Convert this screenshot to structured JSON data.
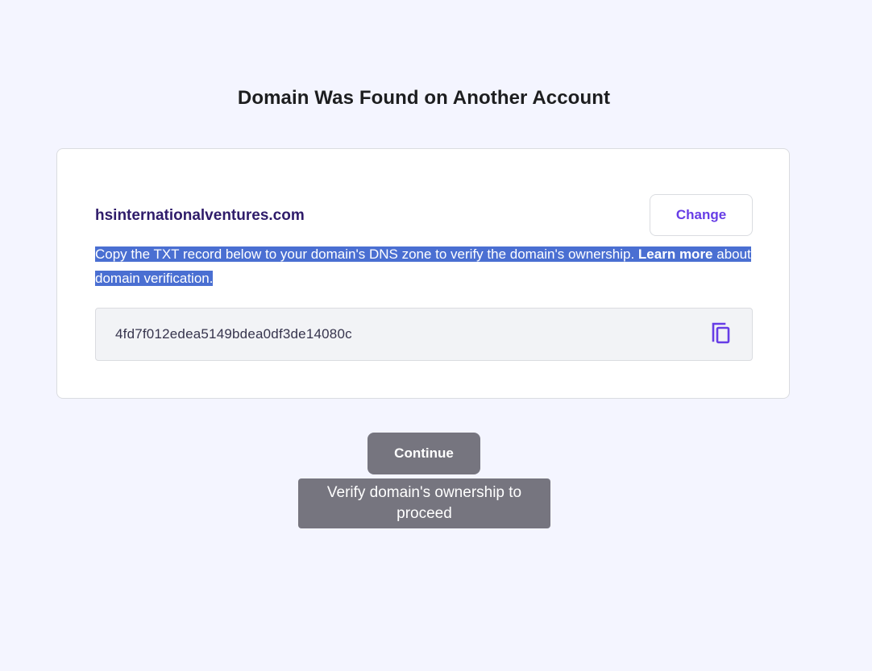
{
  "page": {
    "title": "Domain Was Found on Another Account"
  },
  "card": {
    "domain": "hsinternationalventures.com",
    "change_label": "Change",
    "instructions_text": "Copy the TXT record below to your domain's DNS zone to verify the domain's ownership. ",
    "learn_more_label": "Learn more",
    "instructions_suffix": " about domain verification.",
    "txt_record": "4fd7f012edea5149bdea0df3de14080c",
    "copy_icon": "copy-icon"
  },
  "actions": {
    "continue_label": "Continue",
    "tooltip": "Verify domain's ownership to proceed"
  },
  "colors": {
    "background": "#f4f5ff",
    "accent": "#673de6",
    "domain_text": "#2f1c6a",
    "selection_highlight": "#4a6fd2",
    "disabled_button": "#76757f"
  }
}
